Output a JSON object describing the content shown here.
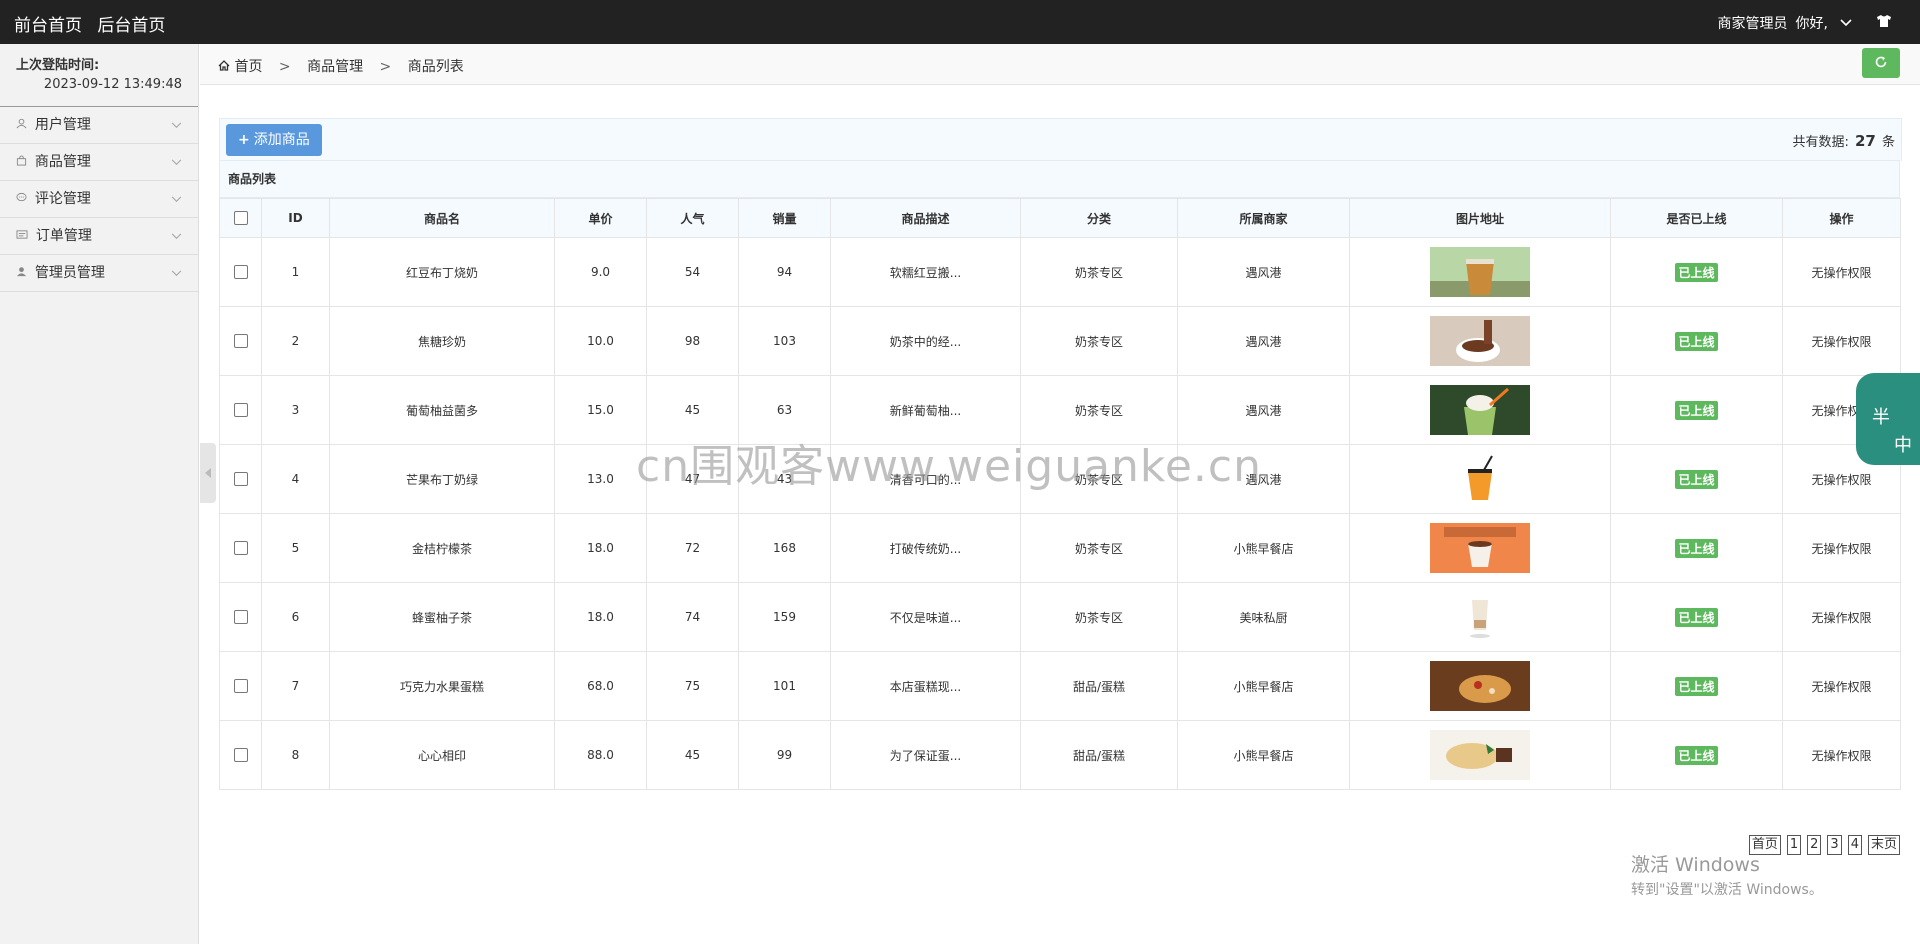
{
  "topbar": {
    "front_home": "前台首页",
    "back_home": "后台首页",
    "role": "商家管理员",
    "greeting": "你好,"
  },
  "sidebar": {
    "last_login_label": "上次登陆时间:",
    "last_login_time": "2023-09-12 13:49:48",
    "items": [
      {
        "label": "用户管理",
        "icon": "user-icon"
      },
      {
        "label": "商品管理",
        "icon": "bag-icon"
      },
      {
        "label": "评论管理",
        "icon": "comment-icon"
      },
      {
        "label": "订单管理",
        "icon": "order-icon"
      },
      {
        "label": "管理员管理",
        "icon": "admin-icon"
      }
    ]
  },
  "breadcrumb": {
    "home": "首页",
    "level1": "商品管理",
    "level2": "商品列表",
    "sep": ">"
  },
  "toolbar": {
    "add_label": "添加商品",
    "total_prefix": "共有数据:",
    "total_count": "27",
    "total_suffix": "条"
  },
  "table": {
    "caption": "商品列表",
    "columns": [
      "ID",
      "商品名",
      "单价",
      "人气",
      "销量",
      "商品描述",
      "分类",
      "所属商家",
      "图片地址",
      "是否已上线",
      "操作"
    ],
    "rows": [
      {
        "id": "1",
        "name": "红豆布丁烧奶",
        "price": "9.0",
        "popularity": "54",
        "sales": "94",
        "desc": "软糯红豆搬...",
        "category": "奶茶专区",
        "merchant": "遇风港",
        "image": "milk-tea-cup",
        "status": "已上线",
        "action": "无操作权限"
      },
      {
        "id": "2",
        "name": "焦糖珍奶",
        "price": "10.0",
        "popularity": "98",
        "sales": "103",
        "desc": "奶茶中的经...",
        "category": "奶茶专区",
        "merchant": "遇风港",
        "image": "chocolate-pour",
        "status": "已上线",
        "action": "无操作权限"
      },
      {
        "id": "3",
        "name": "葡萄柚益菌多",
        "price": "15.0",
        "popularity": "45",
        "sales": "63",
        "desc": "新鲜葡萄柚...",
        "category": "奶茶专区",
        "merchant": "遇风港",
        "image": "green-smoothie",
        "status": "已上线",
        "action": "无操作权限"
      },
      {
        "id": "4",
        "name": "芒果布丁奶绿",
        "price": "13.0",
        "popularity": "47",
        "sales": "43",
        "desc": "清香可口的...",
        "category": "奶茶专区",
        "merchant": "遇风港",
        "image": "mango-drink",
        "status": "已上线",
        "action": "无操作权限"
      },
      {
        "id": "5",
        "name": "金桔柠檬茶",
        "price": "18.0",
        "popularity": "72",
        "sales": "168",
        "desc": "打破传统奶...",
        "category": "奶茶专区",
        "merchant": "小熊早餐店",
        "image": "coffee-cup-orange",
        "status": "已上线",
        "action": "无操作权限"
      },
      {
        "id": "6",
        "name": "蜂蜜柚子茶",
        "price": "18.0",
        "popularity": "74",
        "sales": "159",
        "desc": "不仅是味道...",
        "category": "奶茶专区",
        "merchant": "美味私厨",
        "image": "layered-glass",
        "status": "已上线",
        "action": "无操作权限"
      },
      {
        "id": "7",
        "name": "巧克力水果蛋糕",
        "price": "68.0",
        "popularity": "75",
        "sales": "101",
        "desc": "本店蛋糕现...",
        "category": "甜品/蛋糕",
        "merchant": "小熊早餐店",
        "image": "cake-wood",
        "status": "已上线",
        "action": "无操作权限"
      },
      {
        "id": "8",
        "name": "心心相印",
        "price": "88.0",
        "popularity": "45",
        "sales": "99",
        "desc": "为了保证蛋...",
        "category": "甜品/蛋糕",
        "merchant": "小熊早餐店",
        "image": "dessert-plate",
        "status": "已上线",
        "action": "无操作权限"
      }
    ]
  },
  "pager": {
    "first": "首页",
    "pages": [
      "1",
      "2",
      "3",
      "4"
    ],
    "last": "末页"
  },
  "watermark": "cn围观客www.weiguanke.cn",
  "activation": {
    "line1": "激活 Windows",
    "line2": "转到\"设置\"以激活 Windows。"
  },
  "float_widget": {
    "char1": "半",
    "char2": "中"
  },
  "colors": {
    "topbar": "#222222",
    "accent_blue": "#5a98de",
    "success_green": "#5eb95e",
    "widget_teal": "#2a8f7e"
  }
}
